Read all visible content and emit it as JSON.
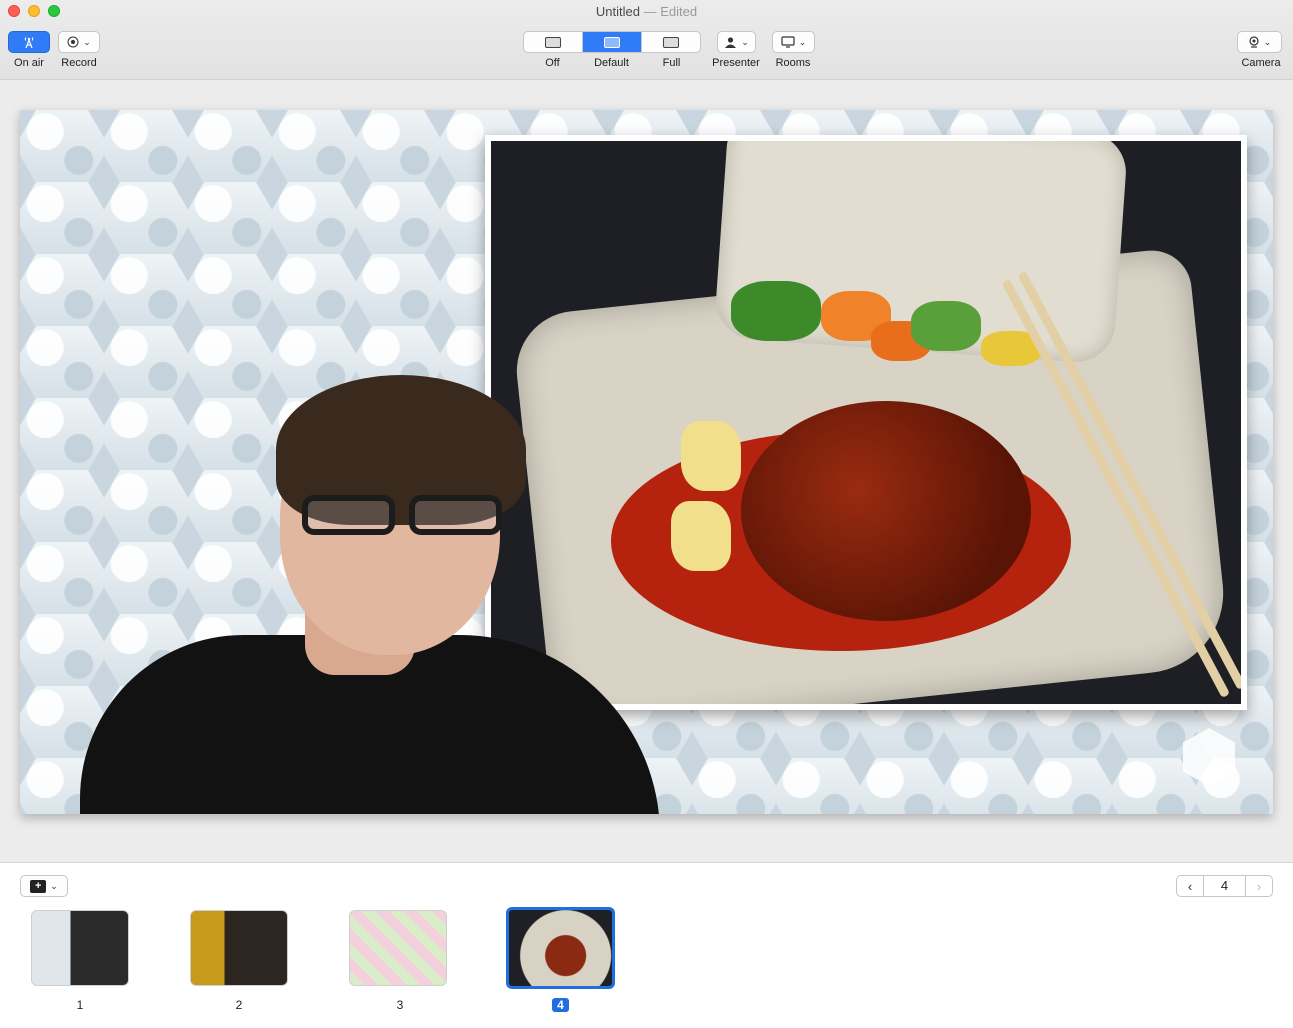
{
  "window": {
    "title": "Untitled",
    "status": "— Edited"
  },
  "toolbar": {
    "on_air": {
      "label": "On air",
      "icon": "broadcast-antenna-icon"
    },
    "record": {
      "label": "Record",
      "icon": "record-icon"
    },
    "layout": {
      "options": [
        "Off",
        "Default",
        "Full"
      ],
      "selected": "Default"
    },
    "presenter": {
      "label": "Presenter",
      "icon": "person-icon"
    },
    "rooms": {
      "label": "Rooms",
      "icon": "display-icon"
    },
    "camera": {
      "label": "Camera",
      "icon": "camera-icon"
    }
  },
  "slides": {
    "items": [
      {
        "number": "1"
      },
      {
        "number": "2"
      },
      {
        "number": "3"
      },
      {
        "number": "4"
      }
    ],
    "selected_index": 4,
    "current_page": "4"
  },
  "colors": {
    "accent": "#2f7cf6",
    "selected_thumb_border": "#1e6fe0"
  }
}
